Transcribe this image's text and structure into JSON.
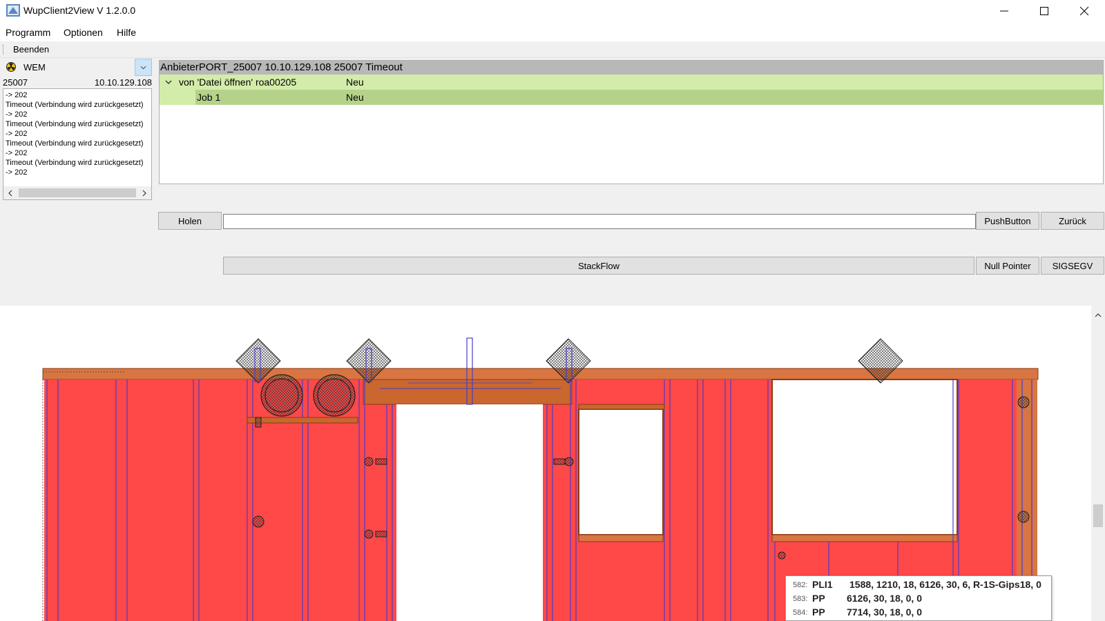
{
  "window": {
    "title": "WupClient2View V 1.2.0.0",
    "controls": [
      "minimize",
      "maximize",
      "close"
    ]
  },
  "menu": {
    "items": [
      "Programm",
      "Optionen",
      "Hilfe"
    ]
  },
  "toolbar": {
    "quit_label": "Beenden"
  },
  "connection": {
    "selected": "WEM",
    "port": "25007",
    "ip": "10.10.129.108"
  },
  "log": {
    "lines": [
      "-> 202",
      "Timeout (Verbindung wird zurückgesetzt)",
      "-> 202",
      "Timeout (Verbindung wird zurückgesetzt)",
      "-> 202",
      "Timeout (Verbindung wird zurückgesetzt)",
      "-> 202",
      "Timeout (Verbindung wird zurückgesetzt)",
      "-> 202"
    ]
  },
  "tree": {
    "header": "AnbieterPORT_25007 10.10.129.108 25007 Timeout",
    "rows": [
      {
        "name": "von 'Datei öffnen' roa00205",
        "status": "Neu"
      },
      {
        "name": "Job 1",
        "status": "Neu"
      }
    ]
  },
  "buttons": {
    "holen": "Holen",
    "pushbutton": "PushButton",
    "zurueck": "Zurück",
    "stackflow": "StackFlow",
    "null_pointer": "Null Pointer",
    "sigsegv": "SIGSEGV"
  },
  "inputs": {
    "command_value": ""
  },
  "drawing": {
    "panel_color": "#ff4848",
    "beam_color": "#c9672e",
    "stud_color": "#4a3cc8",
    "tooltip": [
      {
        "num": "582:",
        "code": "PLI1",
        "values": "1588, 1210, 18, 6126, 30, 6, R-1S-Gips18, 0"
      },
      {
        "num": "583:",
        "code": "PP",
        "values": "6126, 30, 18, 0, 0"
      },
      {
        "num": "584:",
        "code": "PP",
        "values": "7714, 30, 18, 0, 0"
      }
    ]
  }
}
